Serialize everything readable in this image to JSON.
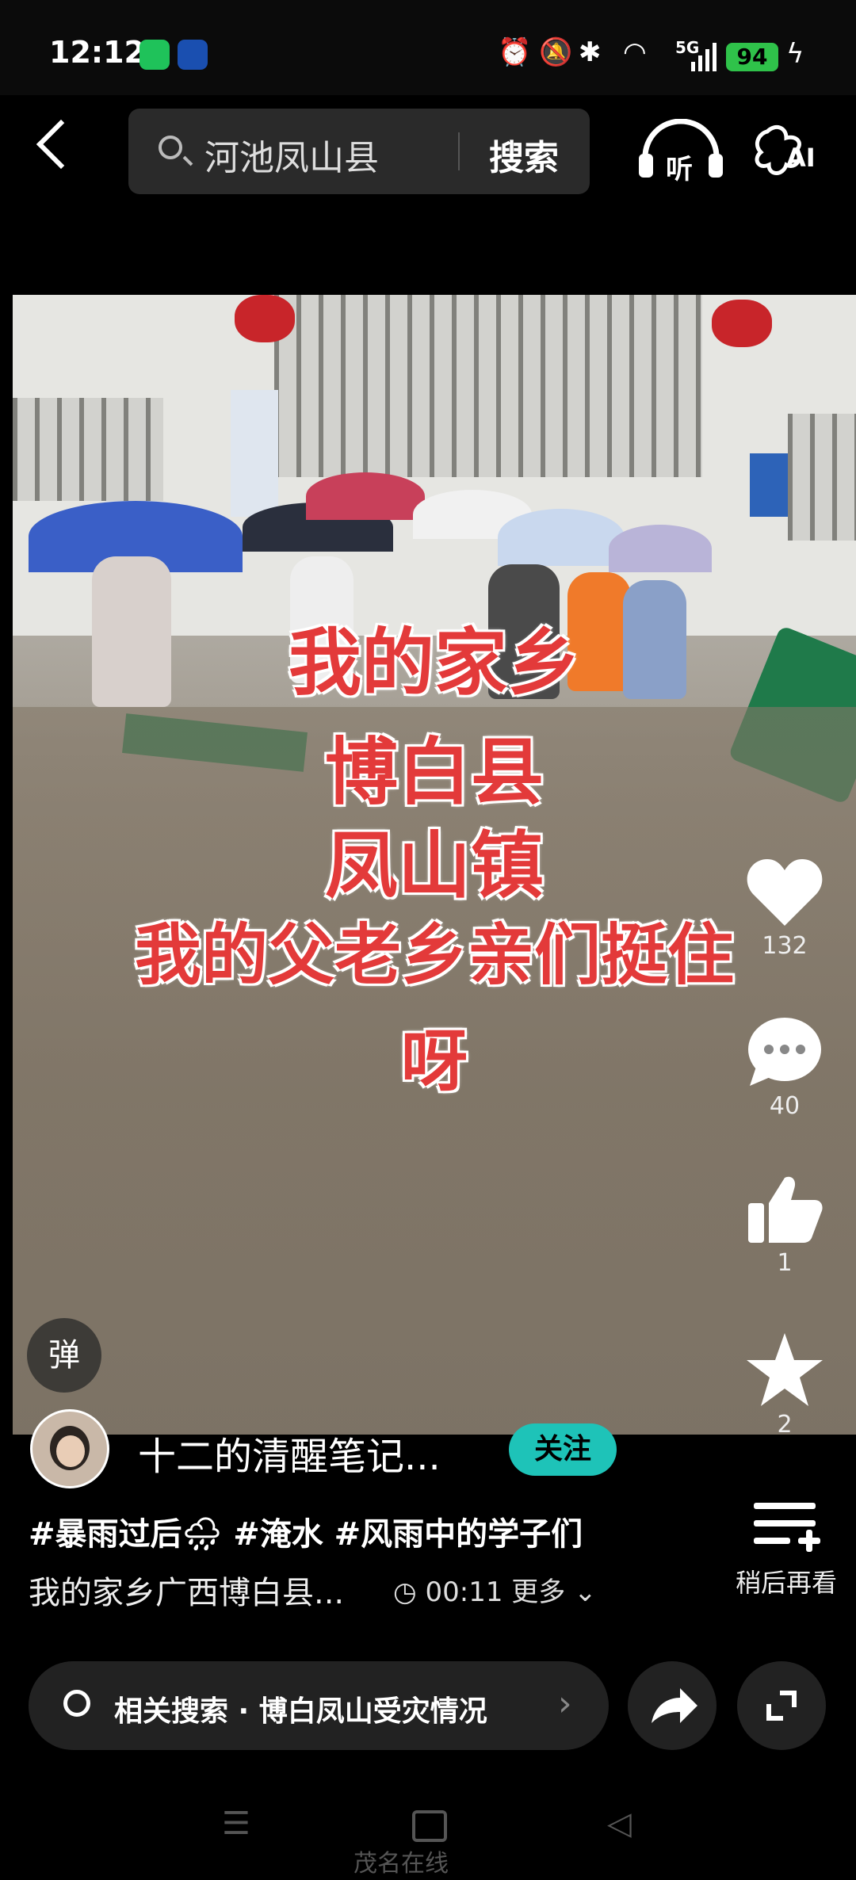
{
  "status": {
    "time": "12:12",
    "network": "5G",
    "battery": "94"
  },
  "search": {
    "query": "河池凤山县",
    "button": "搜索"
  },
  "header": {
    "listen_label": "听",
    "ai_label": "AI"
  },
  "video": {
    "caption_lines": [
      "我的家乡",
      "博白县",
      "凤山镇",
      "我的父老乡亲们挺住",
      "呀"
    ]
  },
  "rail": {
    "likes": "132",
    "comments": "40",
    "thumbs": "1",
    "favorites": "2"
  },
  "danmu_label": "弹",
  "author": {
    "name": "十二的清醒笔记...",
    "follow": "关注"
  },
  "post": {
    "tags": "#暴雨过后🌧 #淹水 #风雨中的学子们",
    "desc": "我的家乡广西博白县...",
    "duration": "00:11",
    "more": "更多"
  },
  "later": {
    "label": "稍后再看"
  },
  "related": {
    "label": "相关搜索 · 博白凤山受灾情况"
  },
  "watermark": "茂名在线"
}
